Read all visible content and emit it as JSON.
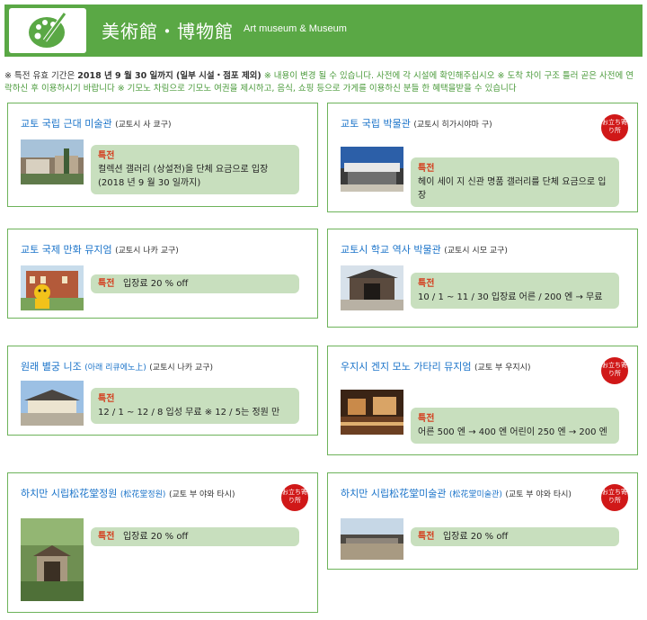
{
  "header": {
    "title": "美術館・博物館",
    "subtitle": "Art museum & Museum"
  },
  "notice": {
    "line1_a": "※ 특전 유효 기간은 ",
    "line1_b": "2018 년 9 월 30 일까지 (일부 시설・점포 제외)",
    "line1_c": "※ 내용이 변경 될 수 있습니다. 사전에 각 시설에 확인해주십시오 ※ 도착 차이 구조 틀러 곧은 사전에 연",
    "line2": "락하신 후 이용하시기 바랍니다 ※ 기모노 차림으로 기모노 여권을 제시하고, 음식, 쇼핑 등으로 가게를 이용하신 분들 한 혜택을받을 수 있습니다"
  },
  "badge_text": "お立ち寄り所",
  "cards": [
    {
      "title": "교토 국립 근대 미술관",
      "location": "(교토시 사 쿄구)",
      "label": "특전",
      "text": "컬렉션 갤러리 (상설전)을 단체 요금으로 입장 (2018 년 9 월 30 일까지)",
      "badge": false
    },
    {
      "title": "교토 국립 박물관",
      "location": "(교토시 히가시야마 구)",
      "label": "특전",
      "text": "헤이 세이 지 신관 명품 갤러리를 단체 요금으로 입장",
      "badge": true
    },
    {
      "title": "교토 국제 만화 뮤지엄",
      "location": "(교토시 나카 교구)",
      "label": "특전",
      "text": "입장료 20 % off",
      "badge": false
    },
    {
      "title": "교토시 학교 역사 박물관",
      "location": "(교토시 시모 교구)",
      "label": "특전",
      "text": "10 / 1 ~ 11 / 30 입장료 어른 / 200 엔 → 무료",
      "badge": false
    },
    {
      "title": "원래 별궁 니조",
      "title_paren": "(아래 리큐에노上)",
      "location": "(교토시 나카 교구)",
      "label": "특전",
      "text": "12 / 1 ~ 12 / 8 입성 무료 ※ 12 / 5는 정원 만",
      "badge": false
    },
    {
      "title": "우지시 겐지 모노 가타리 뮤지엄",
      "location": "(교토 부 우지시)",
      "label": "특전",
      "text": "어른 500 엔 → 400 엔 어린이 250 엔 → 200 엔",
      "badge": true
    },
    {
      "title": "하치만 시립松花堂정원",
      "title_paren": "(松花堂정원)",
      "location": "(교토 부 야와 타시)",
      "label": "특전",
      "text": "입장료 20 % off",
      "badge": true
    },
    {
      "title": "하치만 시립松花堂미술관",
      "title_paren": "(松花堂미술관)",
      "location": "(교토 부 야와 타시)",
      "label": "특전",
      "text": "입장료 20 % off",
      "badge": true
    }
  ]
}
